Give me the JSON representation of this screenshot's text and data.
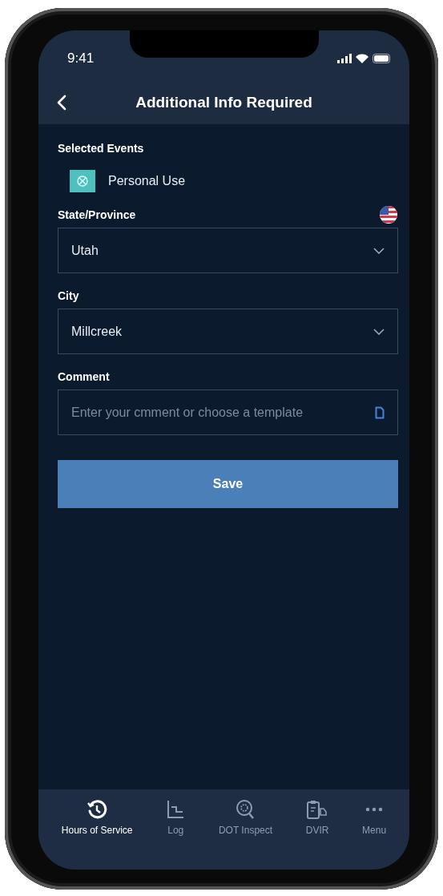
{
  "status_bar": {
    "time": "9:41"
  },
  "header": {
    "title": "Additional Info Required"
  },
  "selected_events": {
    "label": "Selected Events",
    "events": [
      {
        "label": "Personal Use"
      }
    ]
  },
  "fields": [
    {
      "kind": "region-select",
      "label": "State/Province",
      "value": "Utah"
    },
    {
      "kind": "select",
      "label": "City",
      "value": "Millcreek"
    },
    {
      "kind": "text",
      "label": "Comment",
      "placeholder": "Enter your cmment or choose a template"
    }
  ],
  "save_button": {
    "label": "Save"
  },
  "tab_bar": [
    {
      "label": "Hours of Service",
      "selected": true
    },
    {
      "label": "Log",
      "selected": false
    },
    {
      "label": "DOT Inspect",
      "selected": false
    },
    {
      "label": "DVIR",
      "selected": false
    },
    {
      "label": "Menu",
      "selected": false
    }
  ]
}
